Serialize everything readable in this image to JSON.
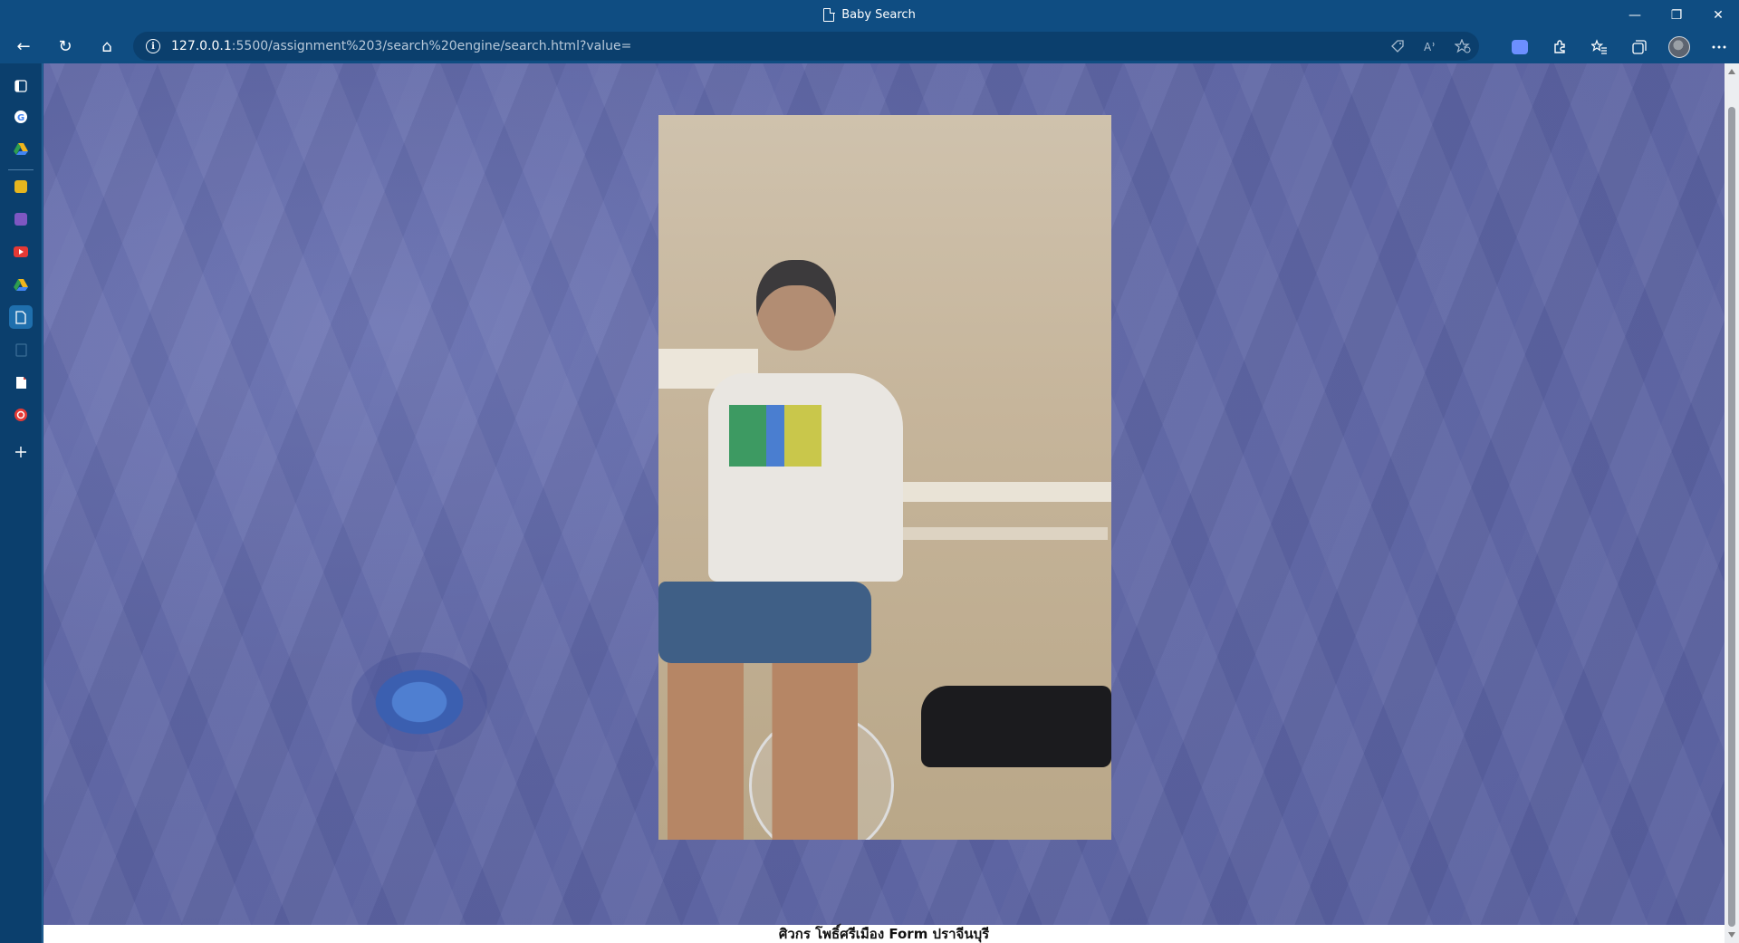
{
  "window": {
    "title": "Baby Search",
    "controls": {
      "minimize": "—",
      "restore": "❐",
      "close": "✕"
    }
  },
  "toolbar": {
    "back": "←",
    "refresh": "↻",
    "home": "⌂",
    "url_host": "127.0.0.1",
    "url_rest": ":5500/assignment%203/search%20engine/search.html?value=",
    "info": "i"
  },
  "address_icons": [
    "tag-icon",
    "read-aloud-icon",
    "add-favorite-icon"
  ],
  "toolbar_icons": [
    "extension-badge-icon",
    "extensions-icon",
    "favorites-icon",
    "collections-icon",
    "profile-avatar",
    "more-icon"
  ],
  "sidebar": {
    "items": [
      {
        "name": "tab-actions",
        "color": "#ffffff"
      },
      {
        "name": "google",
        "color": "#ffffff"
      },
      {
        "name": "drive",
        "color": "#f2b51c"
      },
      {
        "name": "photos-app",
        "color": "#e7b61f"
      },
      {
        "name": "contacts-app",
        "color": "#7e57c2"
      },
      {
        "name": "youtube",
        "color": "#e53935"
      },
      {
        "name": "drive-2",
        "color": "#2e9e4f"
      },
      {
        "name": "document",
        "color": "#ffffff"
      },
      {
        "name": "notepad",
        "color": "#0f2f4f"
      },
      {
        "name": "pdf-reader",
        "color": "#ffffff"
      },
      {
        "name": "red-app",
        "color": "#e53935"
      },
      {
        "name": "add",
        "color": "#ffffff"
      }
    ]
  },
  "content": {
    "background_color": "#6169a6",
    "image_alt": "photo of person dancing in room"
  },
  "footer": {
    "text": "ศิวกร โพธิ์ศรีเมือง Form ปราจีนบุรี"
  }
}
